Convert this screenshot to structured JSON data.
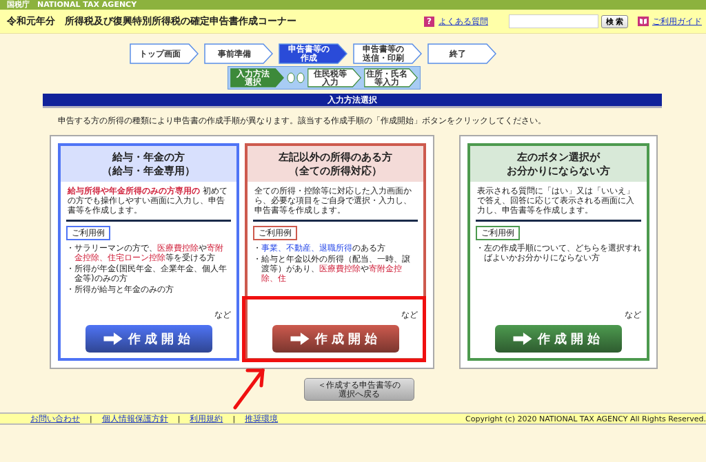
{
  "agency_bar": {
    "title": "国税庁　NATIONAL TAX AGENCY"
  },
  "header": {
    "title": "令和元年分　所得税及び復興特別所得税の確定申告書作成コーナー",
    "help_icon": "?",
    "faq_link": "よくある質問",
    "search_button": "検 索",
    "guide_link": "ご利用ガイド"
  },
  "steps": [
    {
      "label": [
        "トップ画面"
      ],
      "selected": false
    },
    {
      "label": [
        "事前準備"
      ],
      "selected": false
    },
    {
      "label": [
        "申告書等の",
        "作成"
      ],
      "selected": true
    },
    {
      "label": [
        "申告書等の",
        "送信・印刷"
      ],
      "selected": false
    },
    {
      "label": [
        "終了"
      ],
      "selected": false
    }
  ],
  "substeps": [
    {
      "kind": "step",
      "label": [
        "入力方法",
        "選択"
      ],
      "selected": true
    },
    {
      "kind": "dots"
    },
    {
      "kind": "step",
      "label": [
        "住民税等",
        "入力"
      ],
      "selected": false
    },
    {
      "kind": "step",
      "label": [
        "住所・氏名",
        "等入力"
      ],
      "selected": false
    }
  ],
  "section_title": "入力方法選択",
  "instruction": "申告する方の所得の種類により申告書の作成手順が異なります。該当する作成手順の「作成開始」ボタンをクリックしてください。",
  "cards": [
    {
      "color": "#4f74f5",
      "highlighted": false,
      "title": [
        "給与・年金の方",
        "（給与・年金専用）"
      ],
      "description": [
        {
          "kind": "red",
          "text": "給与所得や年金所得のみの方専用の"
        },
        {
          "kind": "plain",
          "text": " 初めての方でも操作しやすい画面に入力し、申告書等を作成します。"
        }
      ],
      "examples_label": "ご利用例",
      "bullet": "・",
      "examples": [
        [
          {
            "kind": "plain",
            "text": "サラリーマンの方で、"
          },
          {
            "kind": "red",
            "text": "医療費控除"
          },
          {
            "kind": "plain",
            "text": "や"
          },
          {
            "kind": "red",
            "text": "寄附金控除、住宅ローン控除"
          },
          {
            "kind": "plain",
            "text": "等を受ける方"
          }
        ],
        [
          {
            "kind": "plain",
            "text": "所得が年金(国民年金、企業年金、個人年金等)のみの方"
          }
        ],
        [
          {
            "kind": "plain",
            "text": "所得が給与と年金のみの方"
          }
        ]
      ],
      "etc": "など",
      "button": "作成開始"
    },
    {
      "color": "#cd5a4e",
      "highlighted": true,
      "title": [
        "左記以外の所得のある方",
        "（全ての所得対応）"
      ],
      "description": [
        {
          "kind": "plain",
          "text": "全ての所得・控除等に対応した入力画面から、必要な項目をご自身で選択・入力し、申告書等を作成します。"
        }
      ],
      "examples_label": "ご利用例",
      "bullet": "・",
      "examples": [
        [
          {
            "kind": "blue",
            "text": "事業、不動産、退職所得"
          },
          {
            "kind": "plain",
            "text": "のある方"
          }
        ],
        [
          {
            "kind": "plain",
            "text": "給与と年金以外の所得（配当、一時、譲渡等）があり、"
          },
          {
            "kind": "red",
            "text": "医療費控除"
          },
          {
            "kind": "plain",
            "text": "や"
          },
          {
            "kind": "red",
            "text": "寄附金控除、住"
          }
        ]
      ],
      "etc": "など",
      "button": "作成開始"
    },
    {
      "color": "#4d9a4f",
      "highlighted": false,
      "title": [
        "左のボタン選択が",
        "お分かりにならない方"
      ],
      "description": [
        {
          "kind": "plain",
          "text": "表示される質問に「はい」又は「いいえ」で答え、回答に応じて表示される画面に入力し、申告書等を作成します。"
        }
      ],
      "examples_label": "ご利用例",
      "bullet": "・",
      "examples": [
        [
          {
            "kind": "plain",
            "text": "左の作成手順について、どちらを選択すればよいかお分かりにならない方"
          }
        ]
      ],
      "etc": "など",
      "button": "作成開始"
    }
  ],
  "back_button": [
    "＜作成する申告書等の",
    "選択へ戻る"
  ],
  "footer": {
    "links": [
      "お問い合わせ",
      "個人情報保護方針",
      "利用規約",
      "推奨環境"
    ],
    "separator": "|",
    "copyright": "Copyright (c) 2020 NATIONAL TAX AGENCY All Rights Reserved."
  }
}
